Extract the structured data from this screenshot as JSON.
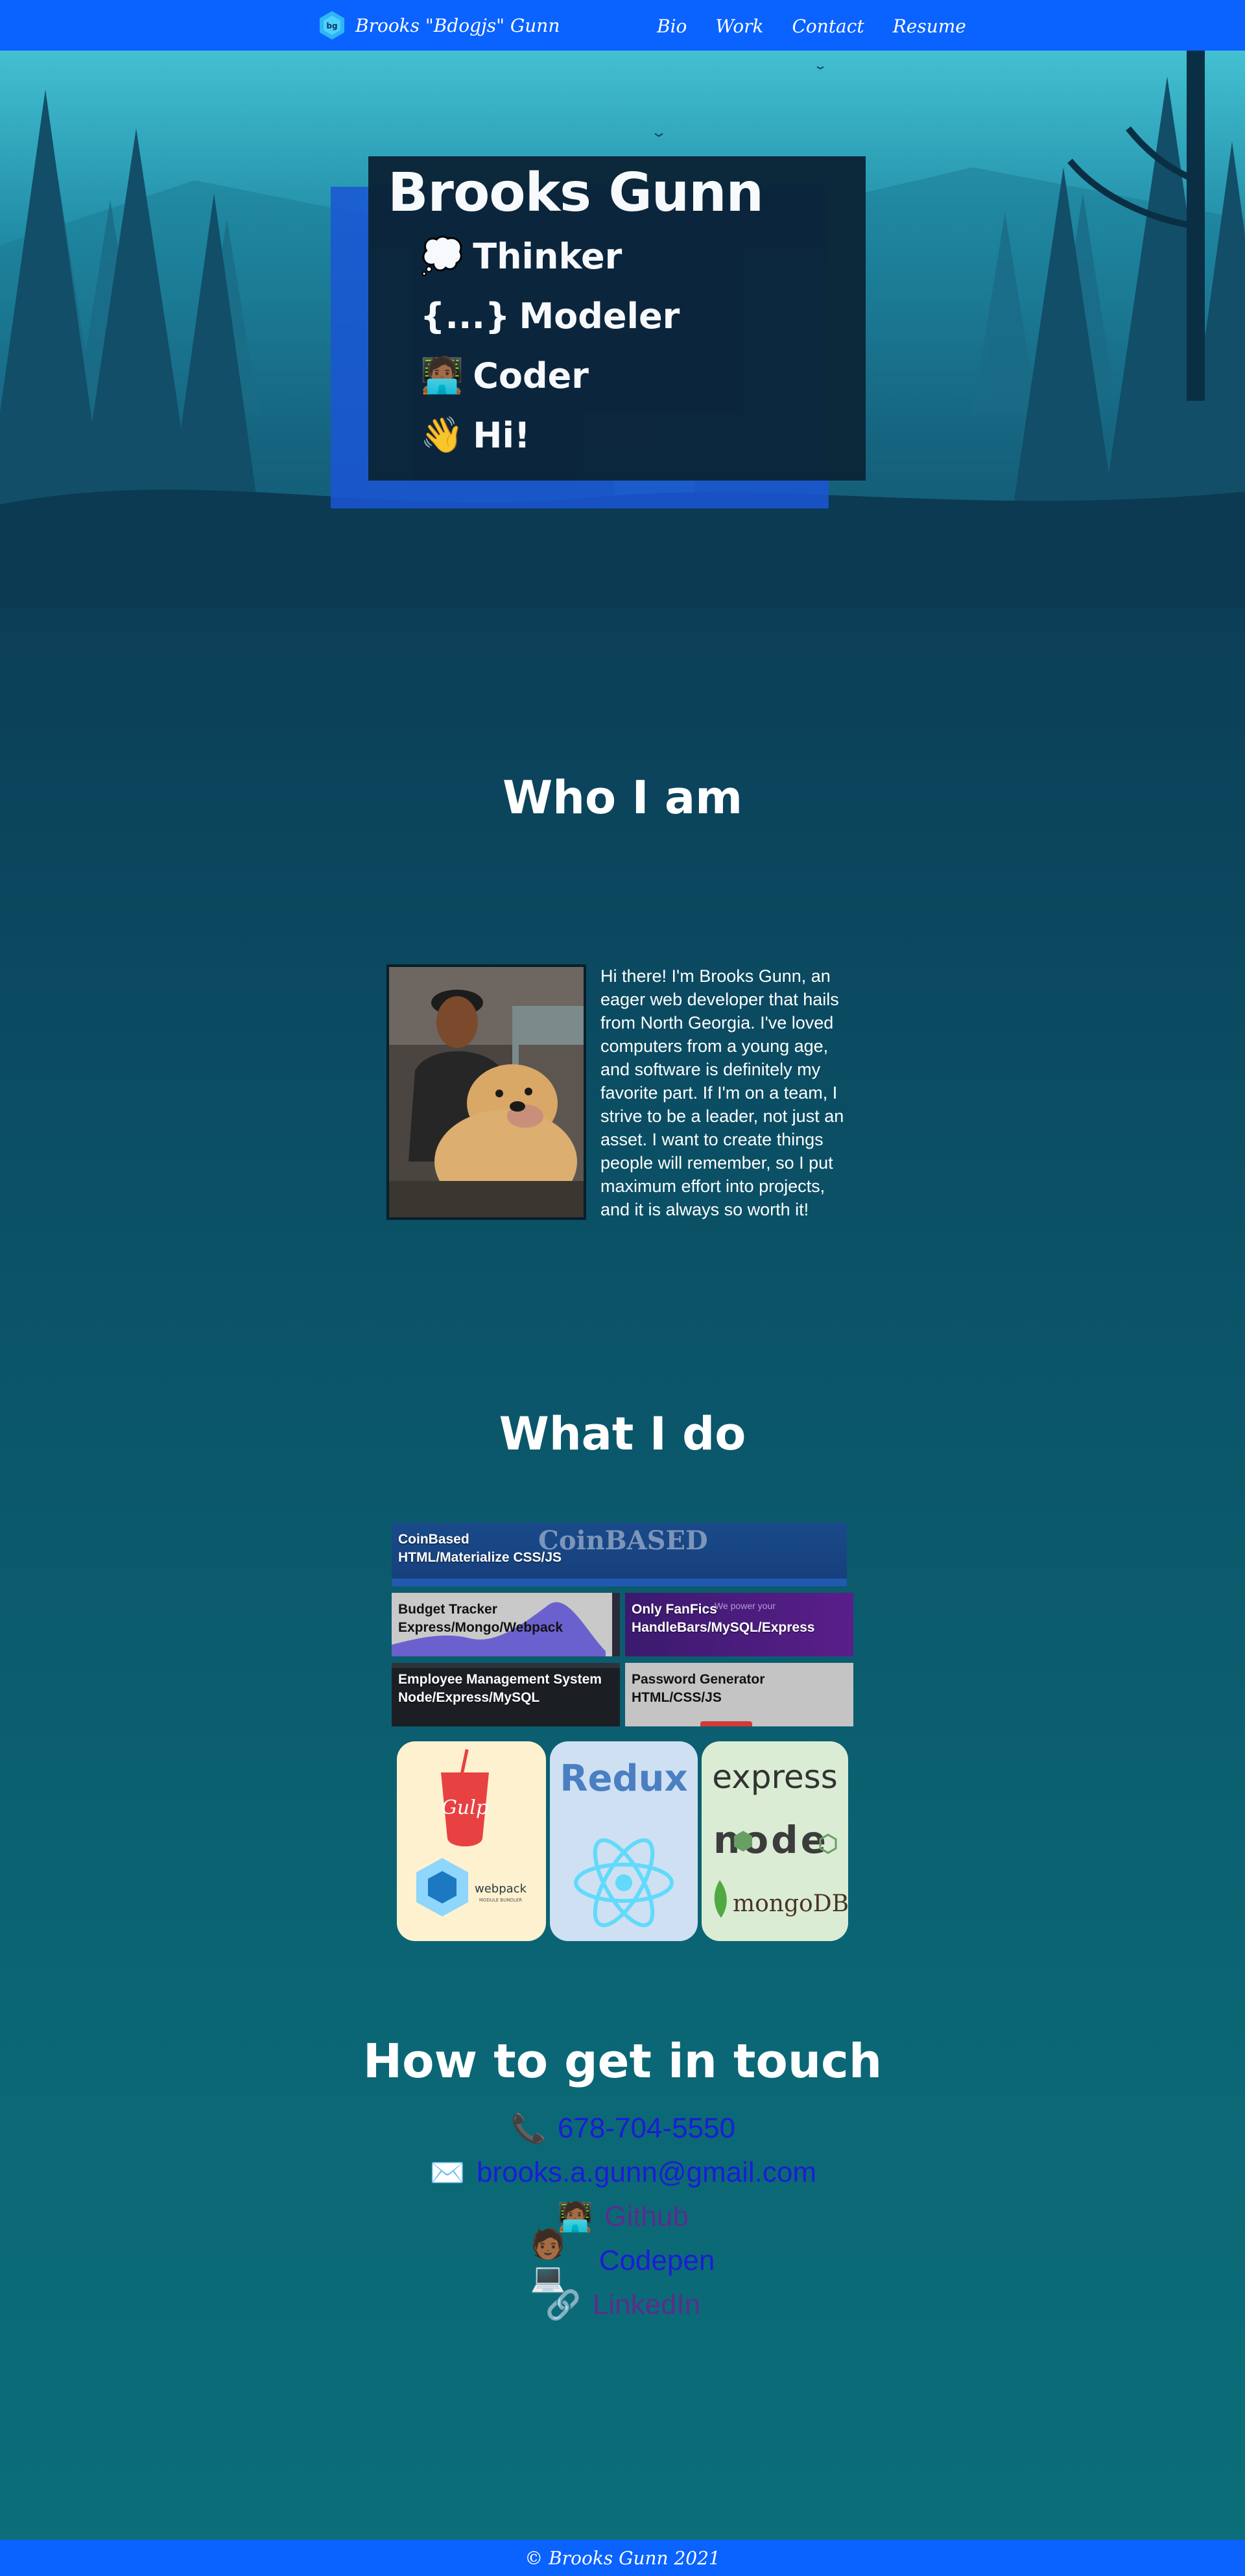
{
  "nav": {
    "brand": "Brooks \"Bdogjs\" Gunn",
    "logo_icon": "hexagon-logo-icon",
    "links": [
      "Bio",
      "Work",
      "Contact",
      "Resume"
    ],
    "color": "#0a62ff"
  },
  "hero": {
    "name": "Brooks Gunn",
    "roles": [
      {
        "icon": "💭",
        "icon_name": "thought-bubble-icon",
        "label": "Thinker"
      },
      {
        "icon": "{...}",
        "icon_name": "braces-icon",
        "label": "Modeler"
      },
      {
        "icon": "🧑🏾‍💻",
        "icon_name": "technologist-icon",
        "label": "Coder"
      },
      {
        "icon": "👋",
        "icon_name": "waving-hand-icon",
        "label": "Hi!"
      }
    ]
  },
  "bio": {
    "title": "Who I am",
    "text": "Hi there! I'm Brooks Gunn, an eager web developer that hails from North Georgia. I've loved computers from a young age, and software is definitely my favorite part. If I'm on a team, I strive to be a leader, not just an asset. I want to create things people will remember, so I put maximum effort into projects, and it is always so worth it!"
  },
  "work": {
    "title": "What I do",
    "projects": [
      {
        "name": "CoinBased",
        "tech": "HTML/Materialize CSS/JS",
        "banner": "CoinBASED"
      },
      {
        "name": "Budget Tracker",
        "tech": "Express/Mongo/Webpack"
      },
      {
        "name": "Only FanFics",
        "tech": "HandleBars/MySQL/Express",
        "tagline": "We power your"
      },
      {
        "name": "Employee Management System",
        "tech": "Node/Express/MySQL"
      },
      {
        "name": "Password Generator",
        "tech": "HTML/CSS/JS"
      }
    ],
    "tech_cards": [
      {
        "logos": [
          "Gulp",
          "webpack"
        ],
        "sub": "MODULE BUNDLER",
        "bg": "#fdf1cf"
      },
      {
        "logos": [
          "Redux"
        ],
        "bg": "#cfe0f3"
      },
      {
        "logos": [
          "express",
          "node",
          "mongoDB"
        ],
        "bg": "#dbecd4"
      }
    ]
  },
  "contact": {
    "title": "How to get in touch",
    "items": [
      {
        "icon": "📞",
        "icon_name": "phone-icon",
        "label": "678-704-5550",
        "style": "blue"
      },
      {
        "icon": "✉️",
        "icon_name": "envelope-icon",
        "label": "brooks.a.gunn@gmail.com",
        "style": "blue"
      },
      {
        "icon": "🧑🏾‍💻",
        "icon_name": "technologist-icon",
        "label": "Github",
        "style": "visited"
      },
      {
        "icon": "🧑🏾💻",
        "icon_name": "face-laptop-icon",
        "label": "Codepen",
        "style": "blue"
      },
      {
        "icon": "🔗",
        "icon_name": "link-icon",
        "label": "LinkedIn",
        "style": "visited"
      }
    ]
  },
  "footer": {
    "text": "© Brooks Gunn 2021"
  }
}
